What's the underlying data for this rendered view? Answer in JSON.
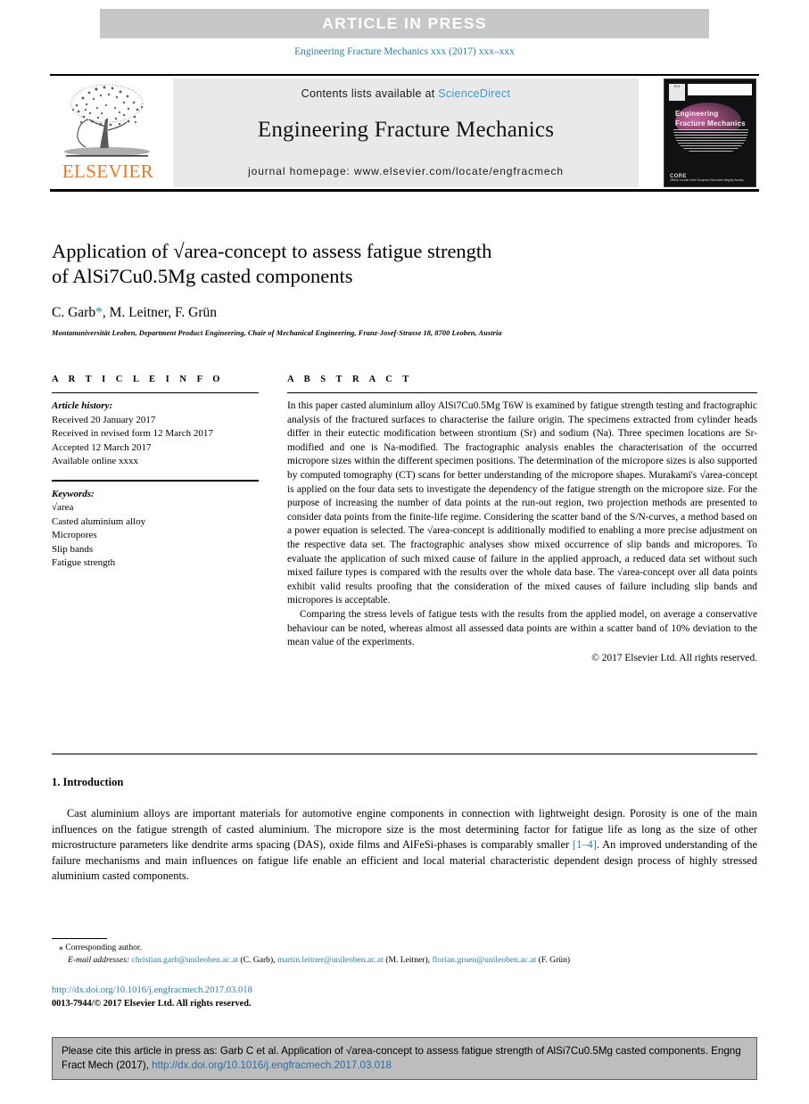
{
  "banner": {
    "text": "ARTICLE  IN  PRESS"
  },
  "running_head": {
    "text": "Engineering Fracture Mechanics xxx (2017) xxx–xxx"
  },
  "masthead": {
    "publisher_logo_label": "ELSEVIER",
    "contents_prefix": "Contents lists available at ",
    "contents_link": "ScienceDirect",
    "journal_title": "Engineering Fracture Mechanics",
    "homepage": "journal homepage: www.elsevier.com/locate/engfracmech",
    "cover": {
      "title_line1": "Engineering",
      "title_line2": "Fracture Mechanics",
      "badge_text": "ELS",
      "foot_brand": "CORE",
      "foot_sub": "Official Journal of the European Structural Integrity Society"
    }
  },
  "article": {
    "title_line1": "Application of √area-concept to assess fatigue strength",
    "title_line2": "of AlSi7Cu0.5Mg casted components",
    "authors": "C. Garb",
    "corresponding_marker": "*",
    "authors_rest": ", M. Leitner, F. Grün",
    "affiliation": "Montanuniversität Leoben, Department Product Engineering, Chair of Mechanical Engineering, Franz-Josef-Strasse 18, 8700 Leoben, Austria"
  },
  "article_info": {
    "heading": "A R T I C L E    I N F O",
    "history_label": "Article history:",
    "history": [
      "Received 20 January 2017",
      "Received in revised form 12 March 2017",
      "Accepted 12 March 2017",
      "Available online xxxx"
    ],
    "keywords_label": "Keywords:",
    "keywords": [
      "√area",
      "Casted aluminium alloy",
      "Micropores",
      "Slip bands",
      "Fatigue strength"
    ]
  },
  "abstract": {
    "heading": "A B S T R A C T",
    "paragraph1": "In this paper casted aluminium alloy AlSi7Cu0.5Mg T6W is examined by fatigue strength testing and fractographic analysis of the fractured surfaces to characterise the failure origin. The specimens extracted from cylinder heads differ in their eutectic modification between strontium (Sr) and sodium (Na). Three specimen locations are Sr-modified and one is Na-modified. The fractographic analysis enables the characterisation of the occurred micropore sizes within the different specimen positions. The determination of the micropore sizes is also supported by computed tomography (CT) scans for better understanding of the micropore shapes. Murakami's √area-concept is applied on the four data sets to investigate the dependency of the fatigue strength on the micropore size. For the purpose of increasing the number of data points at the run-out region, two projection methods are presented to consider data points from the finite-life regime. Considering the scatter band of the S/N-curves, a method based on a power equation is selected. The √area-concept is additionally modified to enabling a more precise adjustment on the respective data set. The fractographic analyses show mixed occurrence of slip bands and micropores. To evaluate the application of such mixed cause of failure in the applied approach, a reduced data set without such mixed failure types is compared with the results over the whole data base. The √area-concept over all data points exhibit valid results proofing that the consideration of the mixed causes of failure including slip bands and micropores is acceptable.",
    "paragraph2": "Comparing the stress levels of fatigue tests with the results from the applied model, on average a conservative behaviour can be noted, whereas almost all assessed data points are within a scatter band of 10% deviation to the mean value of the experiments.",
    "copyright": "© 2017 Elsevier Ltd. All rights reserved."
  },
  "introduction": {
    "heading": "1. Introduction",
    "text_before_ref": "Cast aluminium alloys are important materials for automotive engine components in connection with lightweight design. Porosity is one of the main influences on the fatigue strength of casted aluminium. The micropore size is the most determining factor for fatigue life as long as the size of other microstructure parameters like dendrite arms spacing (DAS), oxide films and AlFeSi-phases is comparably smaller ",
    "reference": "[1–4]",
    "text_after_ref": ". An improved understanding of the failure mechanisms and main influences on fatigue life enable an efficient and local material characteristic dependent design process of highly stressed aluminium casted components."
  },
  "footnotes": {
    "corresponding": "⁎ Corresponding author.",
    "email_label": "E-mail addresses:",
    "emails": [
      {
        "address": "christian.garb@unileoben.ac.at",
        "person": "(C. Garb),"
      },
      {
        "address": "martin.leitner@unileoben.ac.at",
        "person": "(M. Leitner),"
      },
      {
        "address": "florian.gruen@unileoben.ac.at",
        "person": "(F. Grün)"
      }
    ],
    "doi": "http://dx.doi.org/10.1016/j.engfracmech.2017.03.018",
    "issn": "0013-7944/© 2017 Elsevier Ltd. All rights reserved."
  },
  "cite_box": {
    "text_before_link": "Please cite this article in press as: Garb C et al. Application of √area-concept to assess fatigue strength of AlSi7Cu0.5Mg casted components. Engng Fract Mech (2017), ",
    "link": "http://dx.doi.org/10.1016/j.engfracmech.2017.03.018"
  },
  "colors": {
    "banner_bg": "#c6c7c9",
    "link_teal": "#2a7fa5",
    "sciencedirect_blue": "#3a9bd4",
    "elsevier_orange": "#e87722",
    "cite_box_bg": "#bdbdbd"
  }
}
